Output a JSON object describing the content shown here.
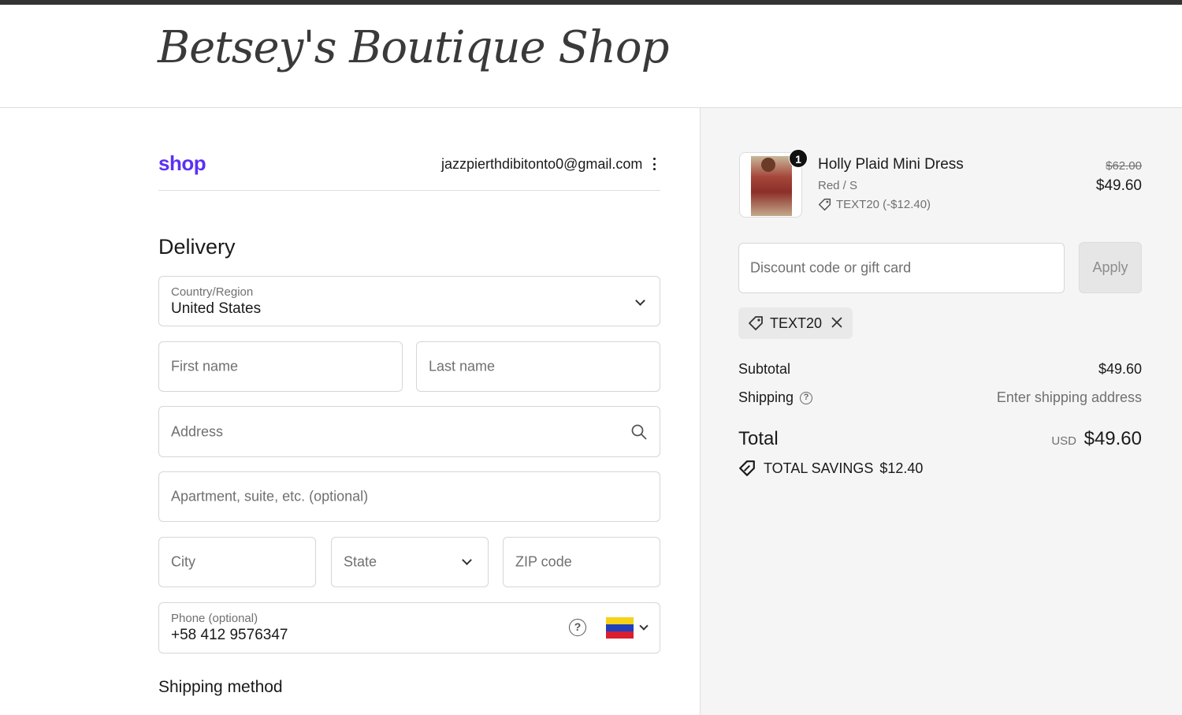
{
  "header": {
    "logo_text": "Betsey's Boutique Shop"
  },
  "account": {
    "shop_logo": "shop",
    "email": "jazzpierthdibitonto0@gmail.com"
  },
  "delivery": {
    "heading": "Delivery",
    "country": {
      "label": "Country/Region",
      "value": "United States"
    },
    "first_name": {
      "placeholder": "First name"
    },
    "last_name": {
      "placeholder": "Last name"
    },
    "address": {
      "placeholder": "Address"
    },
    "apartment": {
      "placeholder": "Apartment, suite, etc. (optional)"
    },
    "city": {
      "placeholder": "City"
    },
    "state": {
      "placeholder": "State"
    },
    "zip": {
      "placeholder": "ZIP code"
    },
    "phone": {
      "label": "Phone (optional)",
      "value": "+58 412 9576347",
      "help_glyph": "?"
    }
  },
  "shipping_method": {
    "heading": "Shipping method"
  },
  "order": {
    "item": {
      "quantity": "1",
      "name": "Holly Plaid Mini Dress",
      "variant": "Red / S",
      "discount": "TEXT20 (-$12.40)",
      "original_price": "$62.00",
      "price": "$49.60"
    },
    "discount_input": {
      "placeholder": "Discount code or gift card"
    },
    "apply_label": "Apply",
    "applied_code": "TEXT20",
    "subtotal": {
      "label": "Subtotal",
      "value": "$49.60"
    },
    "shipping": {
      "label": "Shipping",
      "value": "Enter shipping address",
      "help_glyph": "?"
    },
    "total": {
      "label": "Total",
      "currency": "USD",
      "value": "$49.60"
    },
    "savings": {
      "label": "TOTAL SAVINGS",
      "value": "$12.40"
    }
  },
  "colors": {
    "shop_brand": "#5a31f4",
    "right_panel_bg": "#f5f5f5",
    "border": "#d6d6d6"
  },
  "icons": [
    "kebab-menu-icon",
    "chevron-down-icon",
    "search-icon",
    "help-icon",
    "venezuela-flag-icon",
    "tag-icon",
    "close-icon",
    "savings-tag-icon"
  ]
}
